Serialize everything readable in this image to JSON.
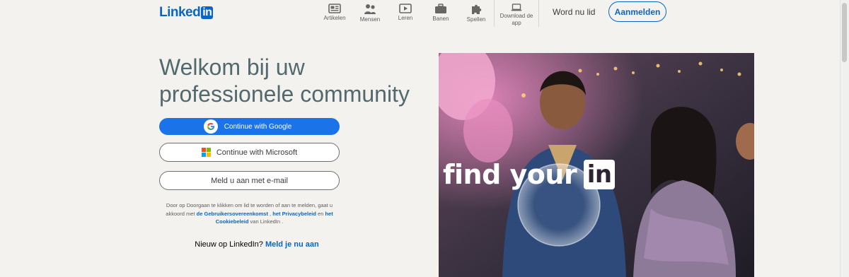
{
  "header": {
    "logo": {
      "text": "Linked",
      "box_text": "in"
    },
    "nav": [
      {
        "label": "Artikelen",
        "icon": "articles-icon"
      },
      {
        "label": "Mensen",
        "icon": "people-icon"
      },
      {
        "label": "Leren",
        "icon": "learning-icon"
      },
      {
        "label": "Banen",
        "icon": "jobs-icon"
      },
      {
        "label": "Spellen",
        "icon": "games-icon"
      },
      {
        "label": "Download de app",
        "icon": "laptop-icon"
      }
    ],
    "join_label": "Word nu lid",
    "signin_label": "Aanmelden"
  },
  "hero": {
    "headline": "Welkom bij uw professionele community",
    "google_label": "Continue with Google",
    "microsoft_label": "Continue with Microsoft",
    "email_label": "Meld u aan met e-mail",
    "terms": {
      "prefix": "Door op Doorgaan te klikken om lid te worden of aan te melden, gaat u akkoord met",
      "user_agreement": "de Gebruikersovereenkomst",
      "sep1": ",",
      "privacy": "het Privacybeleid",
      "and": "en",
      "cookie": "het Cookiebeleid",
      "suffix": "van LinkedIn ."
    },
    "new_prefix": "Nieuw op LinkedIn?",
    "new_link": "Meld je nu aan"
  },
  "photo": {
    "tagline": "find your",
    "tagline_mark": "in"
  },
  "colors": {
    "brand": "#0a66c2",
    "google_button": "#1a73e8",
    "headline": "#526a6e",
    "background": "#f4f2ee"
  }
}
